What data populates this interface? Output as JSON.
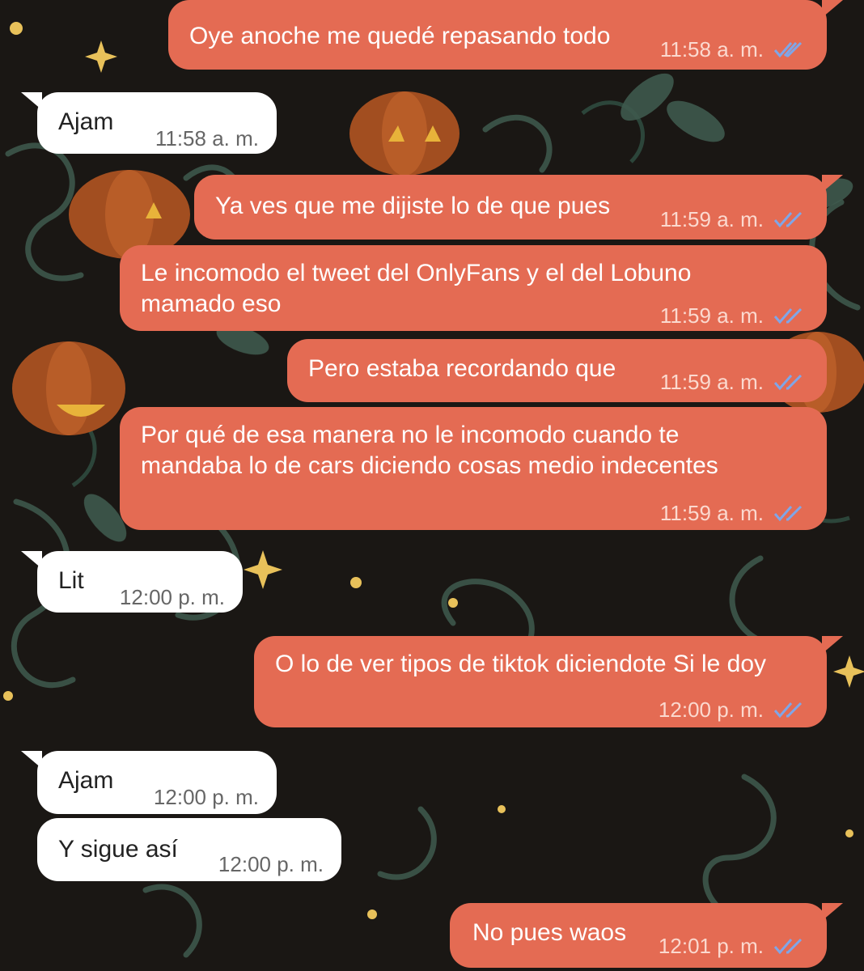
{
  "colors": {
    "outgoing_bubble": "#e46b53",
    "incoming_bubble": "#ffffff",
    "wallpaper": "#1a1714",
    "read_ticks": "#7fa6e8"
  },
  "messages": [
    {
      "direction": "out",
      "text": "Oye anoche me quedé repasando todo",
      "time": "11:58 a. m.",
      "status": "read-ticks-icon"
    },
    {
      "direction": "in",
      "text": "Ajam",
      "time": "11:58 a. m."
    },
    {
      "direction": "out",
      "text": "Ya ves que me dijiste lo de que pues",
      "time": "11:59 a. m.",
      "status": "read-ticks-icon"
    },
    {
      "direction": "out",
      "text": "Le incomodo el tweet del OnlyFans y el del Lobuno\nmamado eso",
      "time": "11:59 a. m.",
      "status": "read-ticks-icon"
    },
    {
      "direction": "out",
      "text": "Pero estaba recordando que",
      "time": "11:59 a. m.",
      "status": "read-ticks-icon"
    },
    {
      "direction": "out",
      "text": "Por qué de esa manera no le incomodo cuando te\nmandaba lo de cars diciendo cosas medio indecentes",
      "time": "11:59 a. m.",
      "status": "read-ticks-icon"
    },
    {
      "direction": "in",
      "text": "Lit",
      "time": "12:00 p. m."
    },
    {
      "direction": "out",
      "text": "O lo de ver tipos de tiktok diciendote Si le doy",
      "time": "12:00 p. m.",
      "status": "read-ticks-icon"
    },
    {
      "direction": "in",
      "text": "Ajam",
      "time": "12:00 p. m."
    },
    {
      "direction": "in",
      "text": "Y sigue así",
      "time": "12:00 p. m."
    },
    {
      "direction": "out",
      "text": "No pues waos",
      "time": "12:01 p. m.",
      "status": "read-ticks-icon"
    }
  ]
}
